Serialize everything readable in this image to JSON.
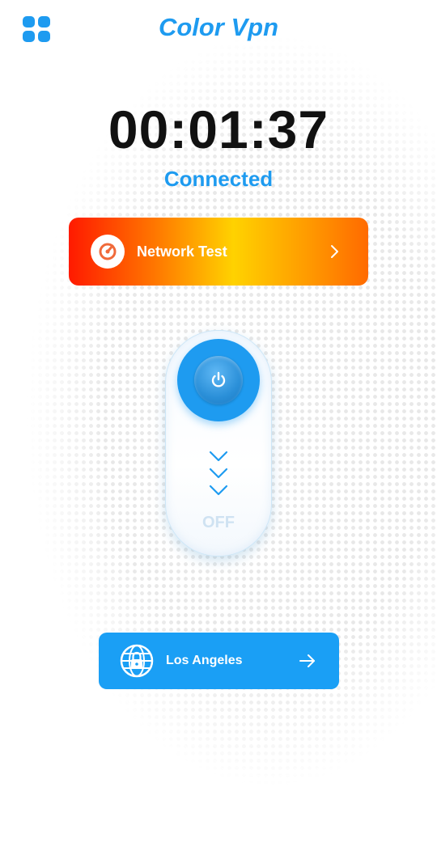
{
  "header": {
    "title": "Color Vpn",
    "menu_icon": "grid-menu-icon"
  },
  "session": {
    "timer": "00:01:37",
    "status": "Connected"
  },
  "network_test": {
    "label": "Network Test",
    "icon": "speedometer-icon",
    "chevron": "chevron-right-icon"
  },
  "toggle": {
    "state_label": "OFF",
    "power_icon": "power-icon",
    "chevrons_icon": "chevrons-down-icon"
  },
  "location": {
    "label": "Los Angeles",
    "icon": "globe-lock-icon",
    "arrow": "arrow-right-icon"
  },
  "colors": {
    "accent": "#1e9bf0",
    "gradient_start": "#ff1a00",
    "gradient_mid": "#ffd200",
    "gradient_end": "#ff6a00"
  }
}
